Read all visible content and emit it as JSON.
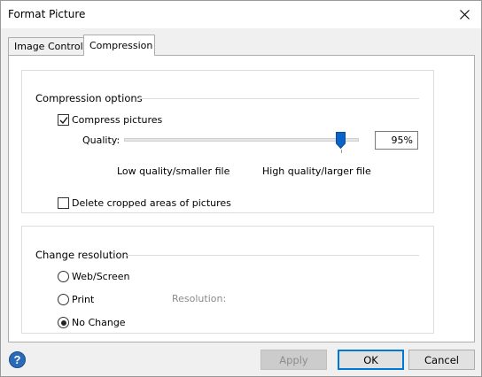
{
  "window": {
    "title": "Format Picture"
  },
  "tabs": [
    {
      "label": "Image Control",
      "active": false
    },
    {
      "label": "Compression",
      "active": true
    }
  ],
  "compression": {
    "header": "Compression options",
    "compress_pictures": {
      "label": "Compress pictures",
      "checked": true
    },
    "quality": {
      "label": "Quality:",
      "value": "95%",
      "value_fraction": 0.95,
      "low_label": "Low quality/smaller file",
      "high_label": "High quality/larger file"
    },
    "delete_cropped": {
      "label": "Delete cropped areas of pictures",
      "checked": false
    }
  },
  "resolution": {
    "header": "Change resolution",
    "options": [
      {
        "label": "Web/Screen",
        "checked": false
      },
      {
        "label": "Print",
        "checked": false
      },
      {
        "label": "No Change",
        "checked": true
      }
    ],
    "resolution_label": "Resolution:"
  },
  "buttons": {
    "help": "?",
    "apply": "Apply",
    "ok": "OK",
    "cancel": "Cancel"
  },
  "colors": {
    "accent": "#0078d7",
    "slider_thumb": "#0a64c8"
  },
  "icons": {
    "close": "close-icon",
    "check": "check-icon",
    "help": "help-icon"
  }
}
